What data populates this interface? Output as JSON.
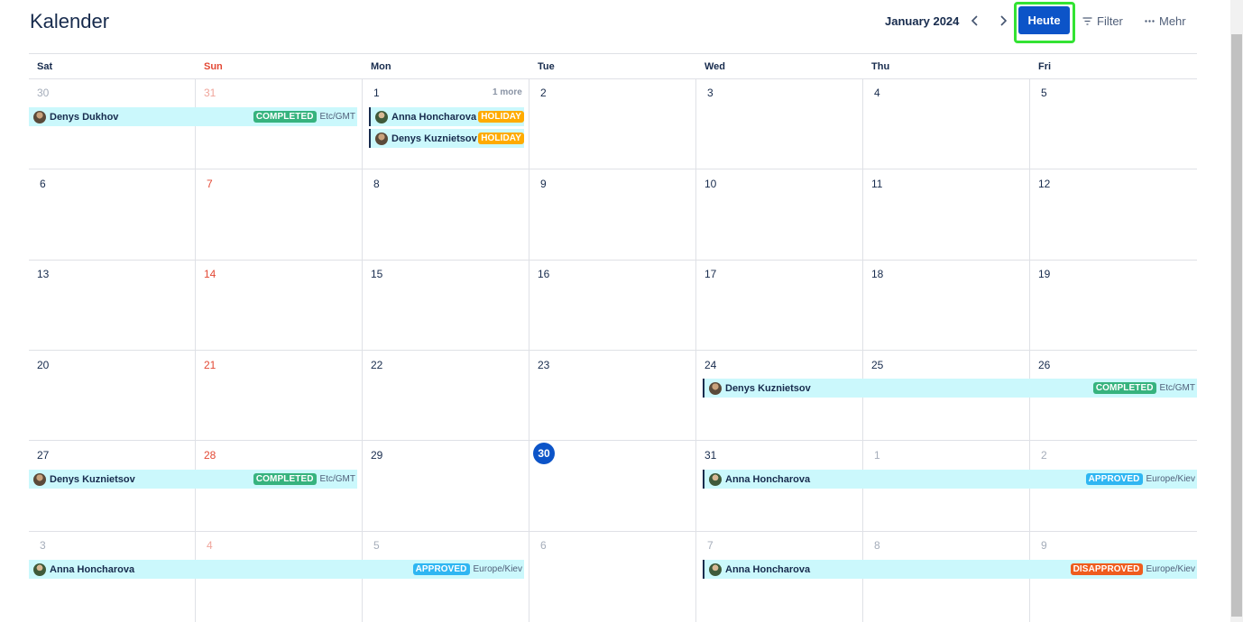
{
  "page": {
    "title": "Kalender"
  },
  "toolbar": {
    "month": "January 2024",
    "today_label": "Heute",
    "filter_label": "Filter",
    "more_label": "Mehr",
    "icons": {
      "prev": "chevron-left-icon",
      "next": "chevron-right-icon",
      "filter": "filter-icon",
      "more": "more-horizontal-icon"
    }
  },
  "weekdays": [
    "Sat",
    "Sun",
    "Mon",
    "Tue",
    "Wed",
    "Thu",
    "Fri"
  ],
  "weeks": [
    [
      "30",
      "31",
      "1",
      "2",
      "3",
      "4",
      "5"
    ],
    [
      "6",
      "7",
      "8",
      "9",
      "10",
      "11",
      "12"
    ],
    [
      "13",
      "14",
      "15",
      "16",
      "17",
      "18",
      "19"
    ],
    [
      "20",
      "21",
      "22",
      "23",
      "24",
      "25",
      "26"
    ],
    [
      "27",
      "28",
      "29",
      "30",
      "31",
      "1",
      "2"
    ],
    [
      "3",
      "4",
      "5",
      "6",
      "7",
      "8",
      "9"
    ]
  ],
  "today": "30",
  "more_link": "1 more",
  "events": [
    {
      "name": "Denys Dukhov",
      "status": "COMPLETED",
      "tz": "Etc/GMT"
    },
    {
      "name": "Anna Honcharova",
      "status": "HOLIDAY",
      "tz": ""
    },
    {
      "name": "Denys Kuznietsov",
      "status": "HOLIDAY",
      "tz": ""
    },
    {
      "name": "Denys Kuznietsov",
      "status": "COMPLETED",
      "tz": "Etc/GMT"
    },
    {
      "name": "Denys Kuznietsov",
      "status": "COMPLETED",
      "tz": "Etc/GMT"
    },
    {
      "name": "Anna Honcharova",
      "status": "APPROVED",
      "tz": "Europe/Kiev"
    },
    {
      "name": "Anna Honcharova",
      "status": "APPROVED",
      "tz": "Europe/Kiev"
    },
    {
      "name": "Anna Honcharova",
      "status": "DISAPPROVED",
      "tz": "Europe/Kiev"
    }
  ],
  "colors": {
    "accent": "#0c54c8",
    "event_bg": "#cbf8fc",
    "completed": "#36b37e",
    "holiday": "#ffab00",
    "approved": "#2fb6f2",
    "disapproved": "#ef5c1e",
    "sunday": "#e34935",
    "highlight": "#33e333"
  }
}
